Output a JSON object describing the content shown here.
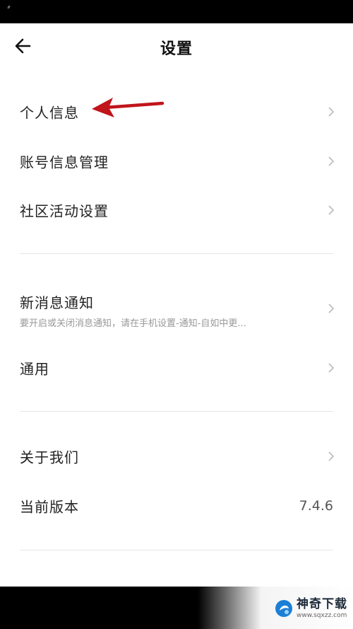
{
  "header": {
    "title": "设置"
  },
  "section1": [
    {
      "label": "个人信息"
    },
    {
      "label": "账号信息管理"
    },
    {
      "label": "社区活动设置"
    }
  ],
  "section2": {
    "notify": {
      "label": "新消息通知",
      "sub": "要开启或关闭消息通知，请在手机设置-通知-自如中更..."
    },
    "general": {
      "label": "通用"
    }
  },
  "section3": {
    "about": {
      "label": "关于我们"
    },
    "version": {
      "label": "当前版本",
      "value": "7.4.6"
    }
  },
  "watermark": {
    "title": "神奇下载",
    "url": "www.sqxzz.com"
  },
  "colors": {
    "annotation": "#c0151b",
    "divider": "#e6e6e6",
    "chevron": "#bbbbbb"
  },
  "icons": {
    "back": "back-arrow-icon",
    "chevron": "chevron-right-icon",
    "annotation": "red-arrow-annotation-icon"
  }
}
